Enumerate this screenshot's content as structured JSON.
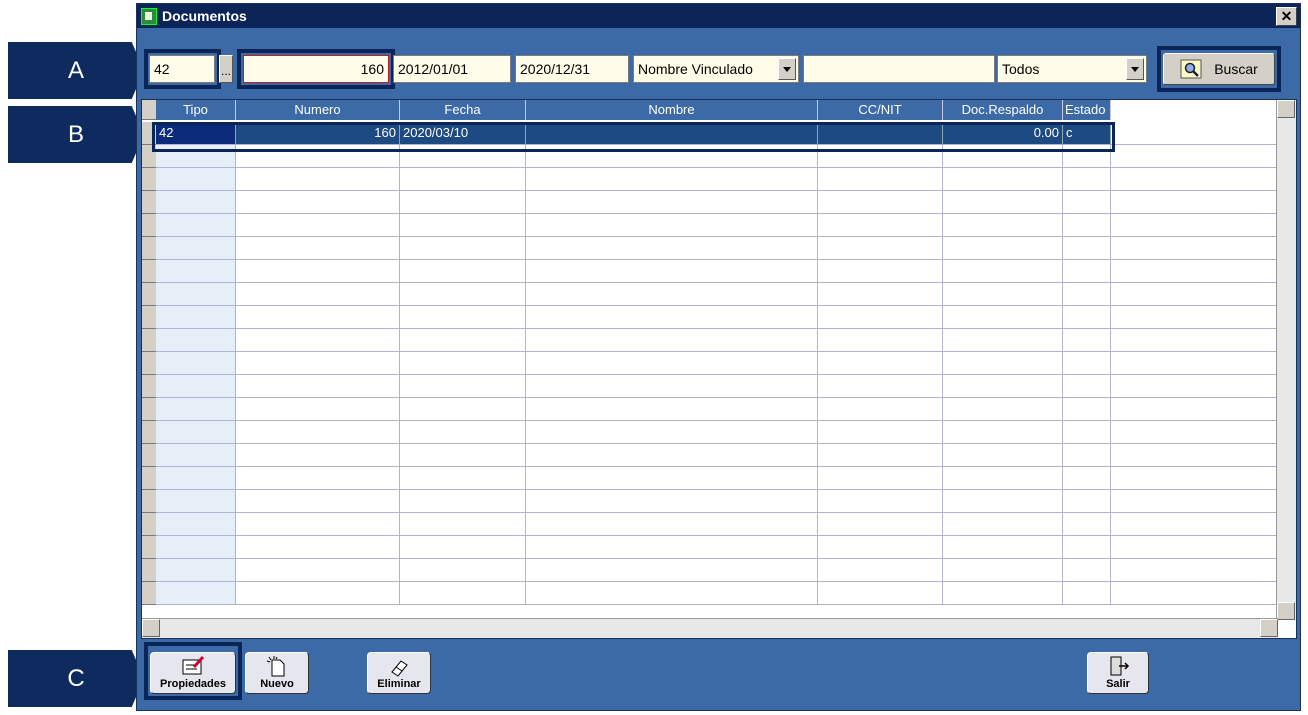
{
  "window": {
    "title": "Documentos",
    "close_label": "✕"
  },
  "callouts": {
    "a": "A",
    "b": "B",
    "c": "C"
  },
  "filters": {
    "tipo": "42",
    "dots": "...",
    "numero": "160",
    "fecha_desde": "2012/01/01",
    "fecha_hasta": "2020/12/31",
    "campo": "Nombre Vinculado",
    "valor": "",
    "estado": "Todos",
    "buscar_label": "Buscar"
  },
  "grid": {
    "columns": [
      "Tipo",
      "Numero",
      "Fecha",
      "Nombre",
      "CC/NIT",
      "Doc.Respaldo",
      "Estado"
    ],
    "rows": [
      {
        "tipo": "42",
        "numero": "160",
        "fecha": "2020/03/10",
        "nombre": "",
        "ccnit": "",
        "doc_respaldo": "0.00",
        "estado": "c"
      }
    ]
  },
  "toolbar": {
    "propiedades": "Propiedades",
    "nuevo": "Nuevo",
    "eliminar": "Eliminar",
    "salir": "Salir"
  },
  "colors": {
    "window_bg": "#3c6aa6",
    "titlebar": "#0c2559",
    "field_bg": "#fffde8",
    "callout": "#0e2a5e"
  }
}
